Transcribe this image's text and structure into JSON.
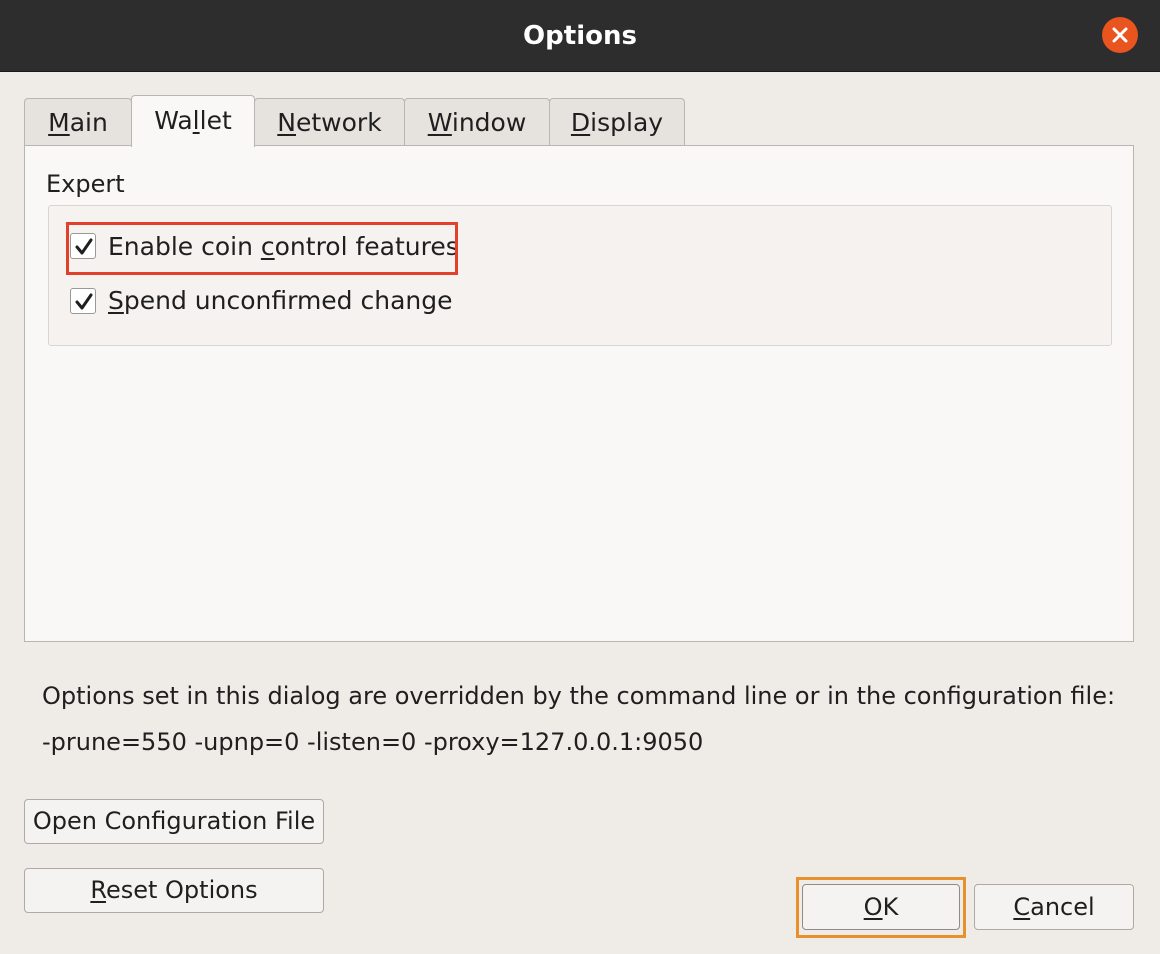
{
  "window": {
    "title": "Options"
  },
  "tabs": [
    {
      "pre": "",
      "mn": "M",
      "post": "ain"
    },
    {
      "pre": "Wa",
      "mn": "l",
      "post": "let"
    },
    {
      "pre": "",
      "mn": "N",
      "post": "etwork"
    },
    {
      "pre": "",
      "mn": "W",
      "post": "indow"
    },
    {
      "pre": "",
      "mn": "D",
      "post": "isplay"
    }
  ],
  "active_tab": "Wallet",
  "expert": {
    "title": "Expert",
    "coin_control": {
      "pre": "Enable coin ",
      "mn": "c",
      "post": "ontrol features",
      "checked": true
    },
    "spend_unconfirmed": {
      "pre": "",
      "mn": "S",
      "post": "pend unconfirmed change",
      "checked": true
    }
  },
  "info": {
    "line1": "Options set in this dialog are overridden by the command line or in the configuration file:",
    "line2": "-prune=550 -upnp=0 -listen=0 -proxy=127.0.0.1:9050"
  },
  "buttons": {
    "open_config": "Open Configuration File",
    "reset": {
      "pre": "",
      "mn": "R",
      "post": "eset Options"
    },
    "ok": {
      "pre": "",
      "mn": "O",
      "post": "K"
    },
    "cancel": {
      "pre": "",
      "mn": "C",
      "post": "ancel"
    }
  },
  "colors": {
    "titlebar": "#2d2d2d",
    "close_button": "#e9541f",
    "highlight_red": "#e2402a",
    "highlight_orange": "#e8912c"
  }
}
